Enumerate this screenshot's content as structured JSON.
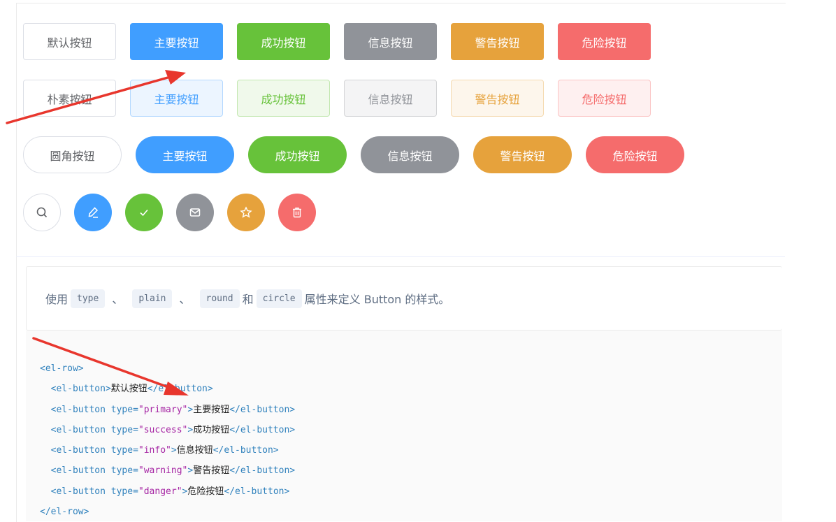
{
  "rows": {
    "basic": [
      "默认按钮",
      "主要按钮",
      "成功按钮",
      "信息按钮",
      "警告按钮",
      "危险按钮"
    ],
    "plain": [
      "朴素按钮",
      "主要按钮",
      "成功按钮",
      "信息按钮",
      "警告按钮",
      "危险按钮"
    ],
    "round": [
      "圆角按钮",
      "主要按钮",
      "成功按钮",
      "信息按钮",
      "警告按钮",
      "危险按钮"
    ],
    "circle_icons": [
      "search-icon",
      "edit-icon",
      "check-icon",
      "message-icon",
      "star-icon",
      "delete-icon"
    ]
  },
  "description": {
    "prefix": "使用",
    "codes": [
      "type",
      "plain",
      "round",
      "circle"
    ],
    "separator": "、",
    "and": "和",
    "suffix": "属性来定义 Button 的样式。"
  },
  "code": {
    "open_row": "<el-row>",
    "close_row": "</el-row>",
    "open_button": "<el-button",
    "close_button": "</el-button>",
    "gt": ">",
    "type_attr": " type=",
    "lines": [
      {
        "type": "",
        "text": "默认按钮"
      },
      {
        "type": "\"primary\"",
        "text": "主要按钮"
      },
      {
        "type": "\"success\"",
        "text": "成功按钮"
      },
      {
        "type": "\"info\"",
        "text": "信息按钮"
      },
      {
        "type": "\"warning\"",
        "text": "警告按钮"
      },
      {
        "type": "\"danger\"",
        "text": "危险按钮"
      }
    ]
  },
  "colors": {
    "primary": "#409eff",
    "success": "#67c23a",
    "info": "#909399",
    "warning": "#e6a23c",
    "danger": "#f56c6c",
    "annotation_arrow": "#e8362d"
  }
}
